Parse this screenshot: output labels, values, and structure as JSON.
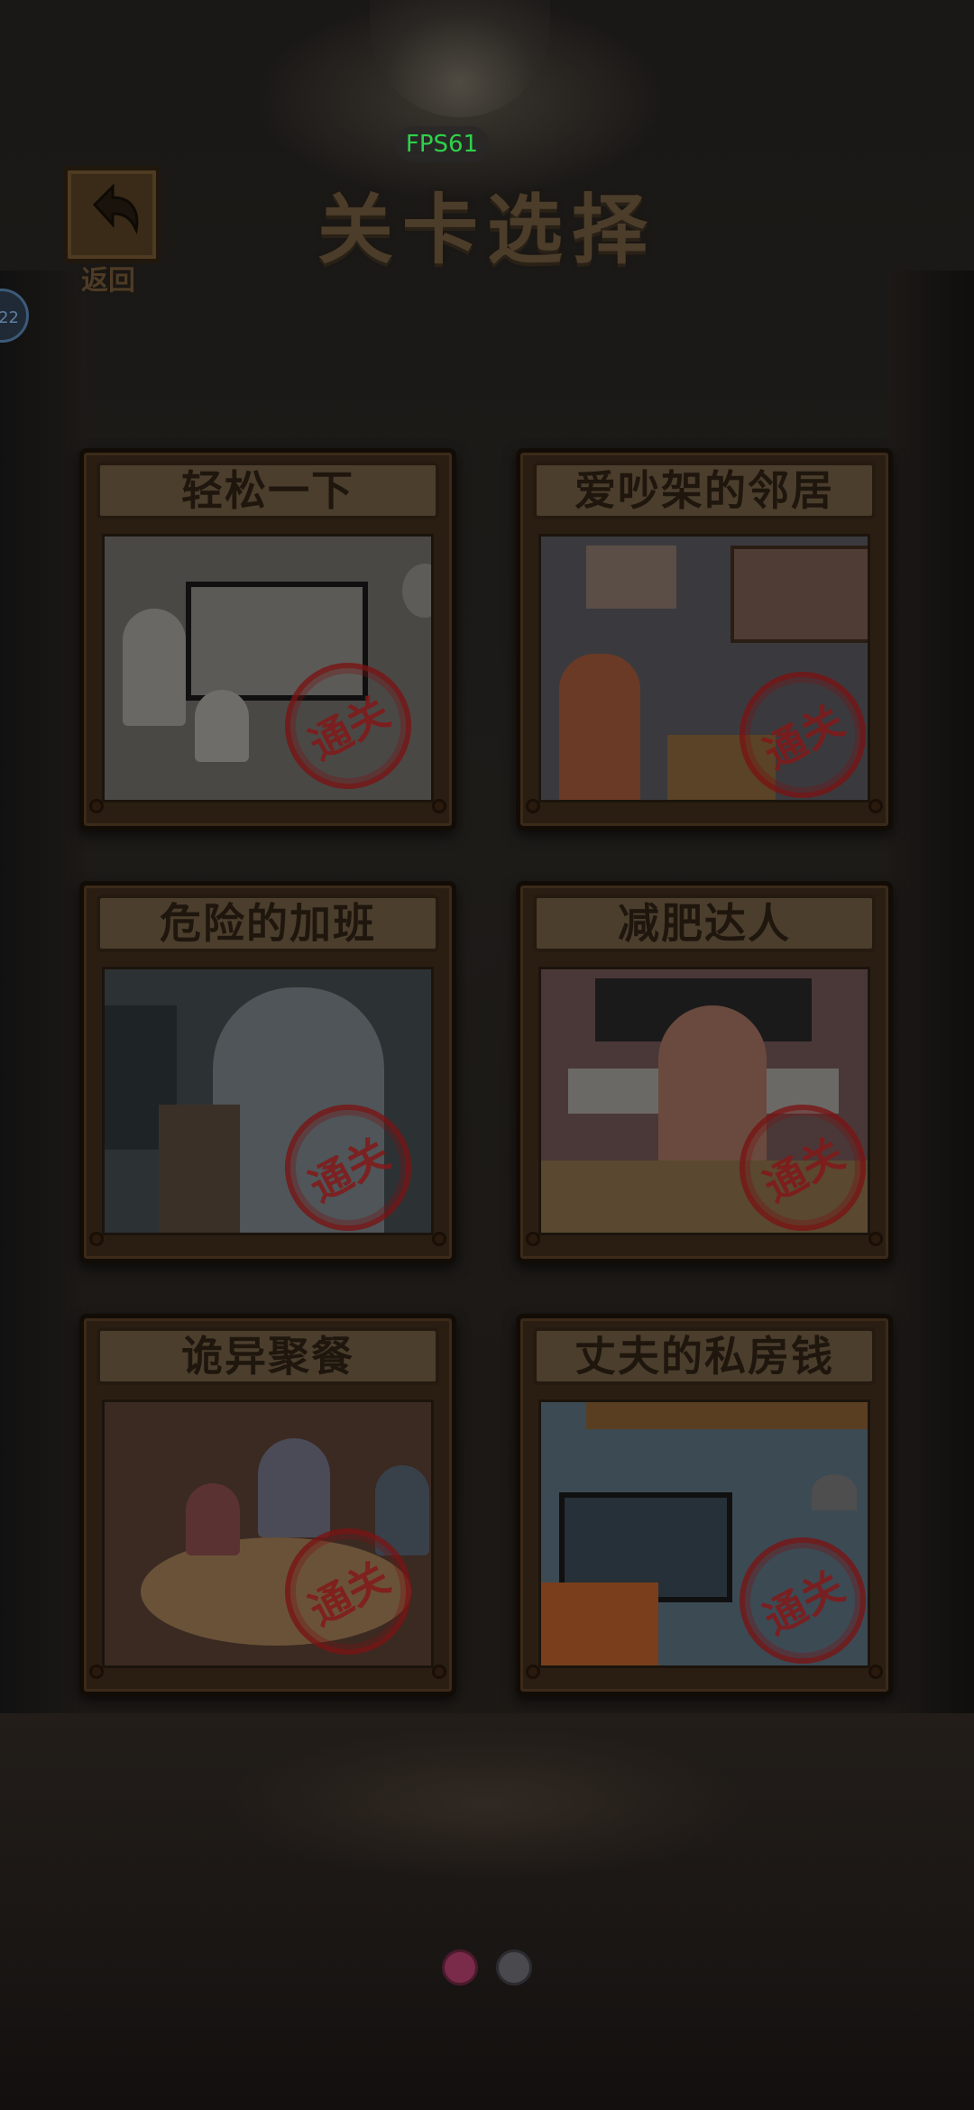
{
  "app": {
    "fps_text": "FPS61",
    "title": "关卡选择",
    "back_label": "返回",
    "side_badge": "22"
  },
  "levels": [
    {
      "title": "轻松一下",
      "stamp": "通关",
      "scene": "tv-audience-sketch"
    },
    {
      "title": "爱吵架的邻居",
      "stamp": "通关",
      "scene": "arguing-couple"
    },
    {
      "title": "危险的加班",
      "stamp": "通关",
      "scene": "office-worker"
    },
    {
      "title": "减肥达人",
      "stamp": "通关",
      "scene": "fitness-woman"
    },
    {
      "title": "诡异聚餐",
      "stamp": "通关",
      "scene": "family-dinner"
    },
    {
      "title": "丈夫的私房钱",
      "stamp": "通关",
      "scene": "living-room-tv"
    }
  ],
  "pagination": {
    "current": 1,
    "total": 2
  },
  "colors": {
    "fps_green": "#2fd24a",
    "stamp_red": "#821919",
    "dot_active": "#7a2b4a"
  },
  "icons": {
    "back": "undo-arrow-icon"
  }
}
